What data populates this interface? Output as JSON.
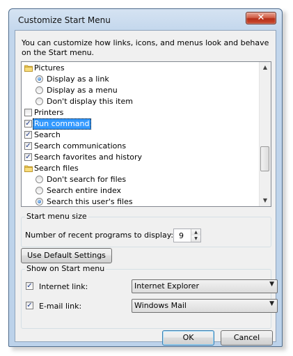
{
  "window": {
    "title": "Customize Start Menu",
    "close_glyph": "✕"
  },
  "intro_text": "You can customize how links, icons, and menus look and behave on the Start menu.",
  "tree": {
    "items": [
      {
        "label": "Pictures",
        "kind": "folder"
      },
      {
        "label": "Display as a link",
        "kind": "radio",
        "selected": true
      },
      {
        "label": "Display as a menu",
        "kind": "radio",
        "selected": false
      },
      {
        "label": "Don't display this item",
        "kind": "radio",
        "selected": false
      },
      {
        "label": "Printers",
        "kind": "checkbox",
        "checked": false
      },
      {
        "label": "Run command",
        "kind": "checkbox",
        "checked": true,
        "highlighted": true
      },
      {
        "label": "Search",
        "kind": "checkbox",
        "checked": true
      },
      {
        "label": "Search communications",
        "kind": "checkbox",
        "checked": true
      },
      {
        "label": "Search favorites and history",
        "kind": "checkbox",
        "checked": true
      },
      {
        "label": "Search files",
        "kind": "folder"
      },
      {
        "label": "Don't search for files",
        "kind": "radio",
        "selected": false
      },
      {
        "label": "Search entire index",
        "kind": "radio",
        "selected": false
      },
      {
        "label": "Search this user's files",
        "kind": "radio",
        "selected": true
      }
    ]
  },
  "start_menu_size": {
    "legend": "Start menu size",
    "label": "Number of recent programs to display:",
    "value": "9"
  },
  "default_button": "Use Default Settings",
  "show_on_start": {
    "legend": "Show on Start menu",
    "internet_label": "Internet link:",
    "internet_checked": true,
    "internet_value": "Internet Explorer",
    "email_label": "E-mail link:",
    "email_checked": true,
    "email_value": "Windows Mail"
  },
  "buttons": {
    "ok": "OK",
    "cancel": "Cancel"
  },
  "icons": {
    "folder": "folder-icon",
    "scroll_up": "scroll-up-arrow-icon",
    "scroll_down": "scroll-down-arrow-icon",
    "dropdown": "chevron-down-icon",
    "check": "checkmark-icon"
  }
}
